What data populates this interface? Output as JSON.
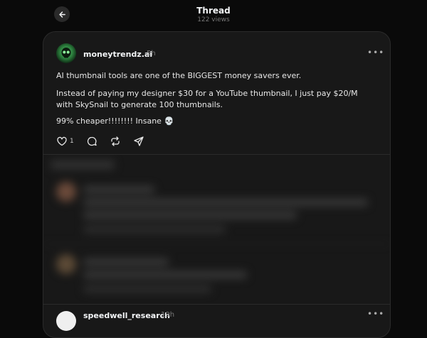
{
  "header": {
    "title": "Thread",
    "views": "122 views"
  },
  "post": {
    "username": "moneytrendz.ai",
    "time": "5h",
    "paragraphs": [
      "AI thumbnail tools are one of the BIGGEST money savers ever.",
      "Instead of paying my designer $30 for a YouTube thumbnail, I just pay $20/M with SkySnail to generate 100 thumbnails.",
      "99% cheaper!!!!!!!! Insane 💀"
    ],
    "likes": "1",
    "icons": [
      "heart-icon",
      "comment-icon",
      "repost-icon",
      "share-icon",
      "more-icon"
    ]
  },
  "reply": {
    "username": "speedwell_research",
    "time": "19h"
  },
  "colors": {
    "background": "#0a0a0a",
    "card": "#181818",
    "text": "#f3f5f7",
    "muted": "#777777"
  }
}
